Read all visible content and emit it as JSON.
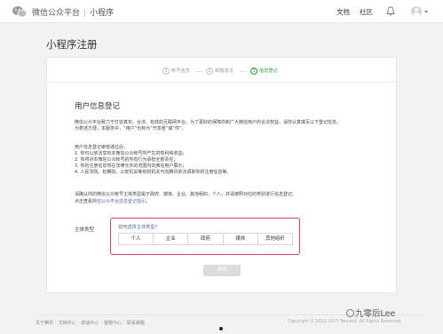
{
  "header": {
    "platform_name": "微信公众平台",
    "separator": "|",
    "section_name": "小程序",
    "nav": [
      "文档",
      "社区"
    ],
    "icons": [
      "wechat-logo-icon",
      "bell-icon",
      "avatar-icon",
      "chevron-down-icon"
    ]
  },
  "page": {
    "title": "小程序注册"
  },
  "steps": [
    {
      "num": "1",
      "label": "帐号信息",
      "state": "done"
    },
    {
      "num": "2",
      "label": "邮箱激活",
      "state": "done"
    },
    {
      "num": "3",
      "label": "信息登记",
      "state": "active"
    }
  ],
  "section": {
    "title": "用户信息登记",
    "intro": [
      "微信公众平台致力于打造真实、合法、有效的互联网平台。为了更好的保障你和广大微信用户的合法权益，请你认真填写以下登记信息。",
      "为表述方便，本服务中，“用户”也称为“开发者”或“你”。"
    ],
    "rules_title": "用户信息登记审核通过后：",
    "rules": [
      "1. 你可以依法享有本微信公众帐号所产生的权利和收益；",
      "2. 你将对本微信公众帐号的所有行为承担全部责任；",
      "3. 你的注册信息将在法律允许的范围内向微信用户展示；",
      "4. 人民法院、检察院、公安机关等有权机关可向腾讯依法调取你的注册信息等。"
    ],
    "confirm": "请确认你的微信公众帐号主体类型属于政府、媒体、企业、其他组织、个人，并请按照对应的类别进行信息登记。",
    "view_prefix": "点击查看",
    "view_link": "微信公众平台信息登记指引",
    "view_suffix": "。"
  },
  "subject": {
    "label": "主体类型",
    "question": "如何选择主体类型?",
    "options": [
      "个人",
      "企业",
      "政府",
      "媒体",
      "其他组织"
    ]
  },
  "next_button": "继续",
  "footer": {
    "links": [
      "关于腾讯",
      "文档中心",
      "辟谣中心",
      "客服中心",
      "联系邮箱"
    ],
    "separator": "|",
    "copyright": "Copyright © 2012-2017 Tencent. All Rights Reserved."
  },
  "watermark": "九零后Lee"
}
